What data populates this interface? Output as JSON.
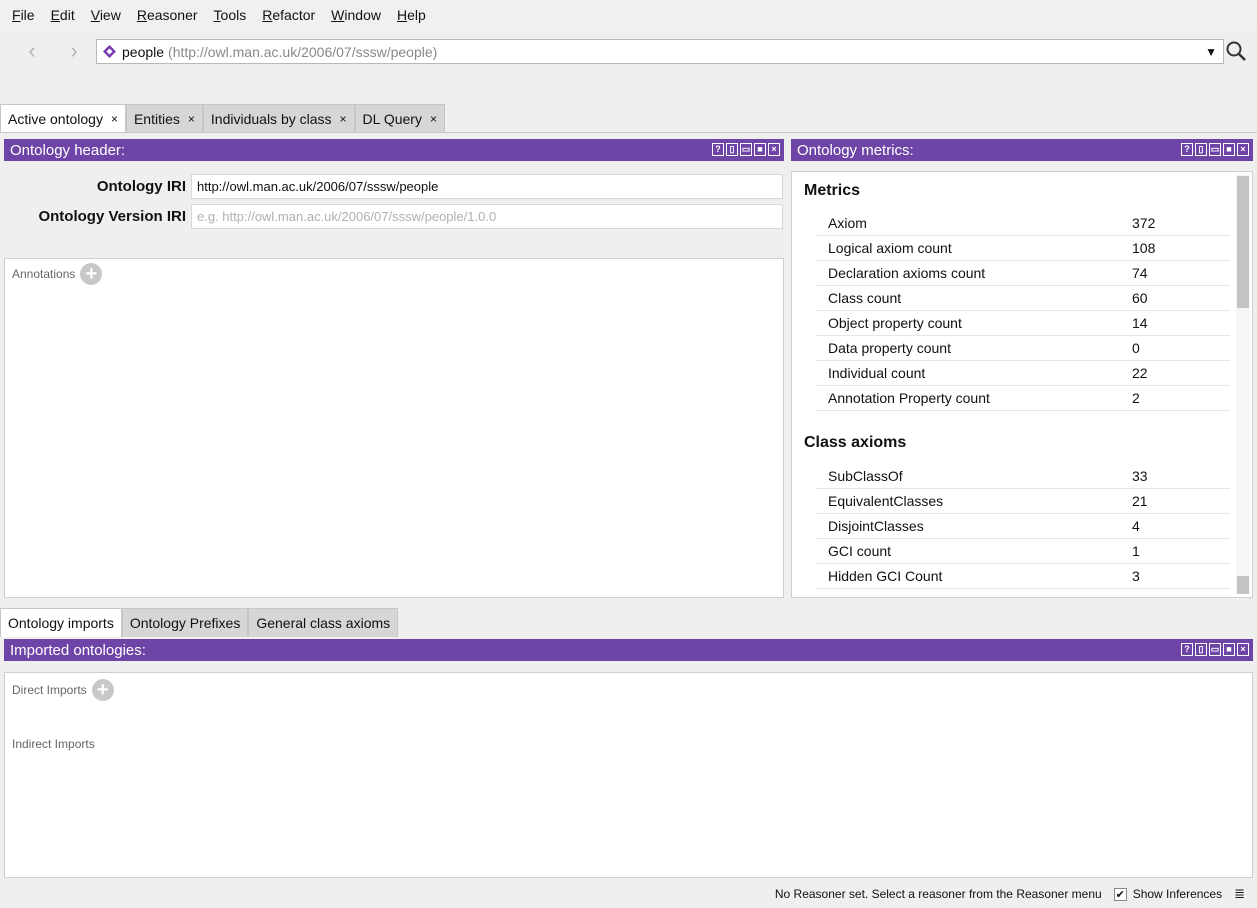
{
  "menu": [
    {
      "label": "File",
      "key": "F"
    },
    {
      "label": "Edit",
      "key": "E"
    },
    {
      "label": "View",
      "key": "V"
    },
    {
      "label": "Reasoner",
      "key": "R"
    },
    {
      "label": "Tools",
      "key": "T"
    },
    {
      "label": "Refactor",
      "key": "R"
    },
    {
      "label": "Window",
      "key": "W"
    },
    {
      "label": "Help",
      "key": "H"
    }
  ],
  "nav": {
    "back_icon": "chevron-left-icon",
    "forward_icon": "chevron-right-icon",
    "ontology_name": "people",
    "ontology_iri": "(http://owl.man.ac.uk/2006/07/sssw/people)",
    "search_icon": "search-icon"
  },
  "tabs": [
    {
      "label": "Active ontology",
      "close": "×"
    },
    {
      "label": "Entities",
      "close": "×"
    },
    {
      "label": "Individuals by class",
      "close": "×"
    },
    {
      "label": "DL Query",
      "close": "×"
    }
  ],
  "header_panel": {
    "title": "Ontology header:",
    "iri_label": "Ontology IRI",
    "iri_value": "http://owl.man.ac.uk/2006/07/sssw/people",
    "version_label": "Ontology Version IRI",
    "version_placeholder": "e.g. http://owl.man.ac.uk/2006/07/sssw/people/1.0.0",
    "annotations_label": "Annotations"
  },
  "metrics_panel": {
    "title": "Ontology metrics:",
    "metrics_heading": "Metrics",
    "metrics": [
      {
        "name": "Axiom",
        "value": "372"
      },
      {
        "name": "Logical axiom count",
        "value": "108"
      },
      {
        "name": "Declaration axioms count",
        "value": "74"
      },
      {
        "name": "Class count",
        "value": "60"
      },
      {
        "name": "Object property count",
        "value": "14"
      },
      {
        "name": "Data property count",
        "value": "0"
      },
      {
        "name": "Individual count",
        "value": "22"
      },
      {
        "name": "Annotation Property count",
        "value": "2"
      }
    ],
    "class_axioms_heading": "Class axioms",
    "class_axioms": [
      {
        "name": "SubClassOf",
        "value": "33"
      },
      {
        "name": "EquivalentClasses",
        "value": "21"
      },
      {
        "name": "DisjointClasses",
        "value": "4"
      },
      {
        "name": "GCI count",
        "value": "1"
      },
      {
        "name": "Hidden GCI Count",
        "value": "3"
      }
    ]
  },
  "lower_tabs": [
    {
      "label": "Ontology imports"
    },
    {
      "label": "Ontology Prefixes"
    },
    {
      "label": "General class axioms"
    }
  ],
  "imports_panel": {
    "title": "Imported ontologies:",
    "direct_label": "Direct Imports",
    "indirect_label": "Indirect Imports"
  },
  "status": {
    "message": "No Reasoner set. Select a reasoner from the Reasoner menu",
    "show_inferences": "Show Inferences",
    "show_inferences_checked": true
  },
  "colors": {
    "panel_header": "#6e45a6",
    "ontology_icon": "#7b3bb0"
  }
}
